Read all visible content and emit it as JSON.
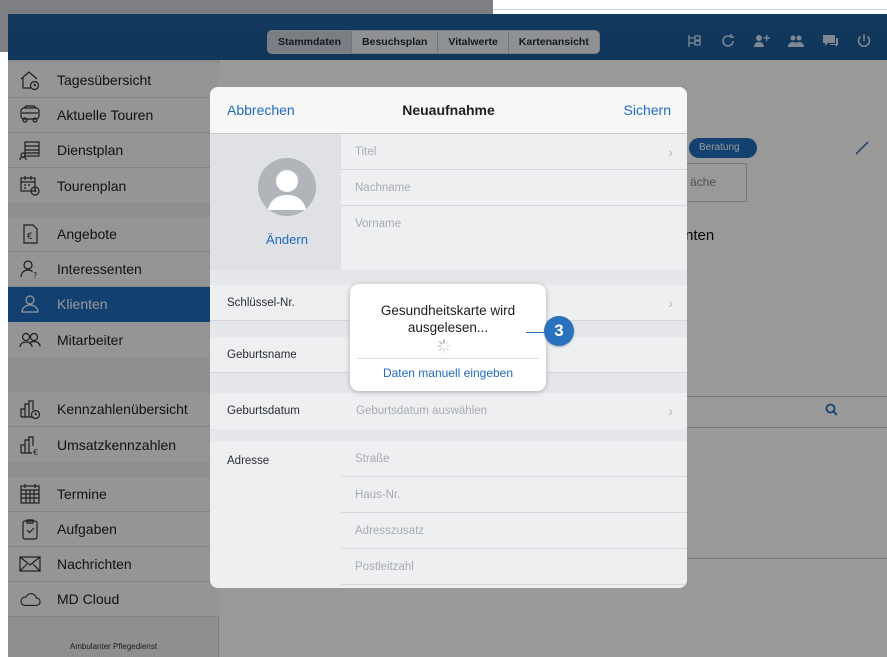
{
  "topbar": {
    "tabs": [
      {
        "label": "Stammdaten",
        "active": true
      },
      {
        "label": "Besuchsplan",
        "active": false
      },
      {
        "label": "Vitalwerte",
        "active": false
      },
      {
        "label": "Kartenansicht",
        "active": false
      }
    ],
    "icons": [
      "tree-icon",
      "refresh-icon",
      "add-user-icon",
      "group-icon",
      "chat-icon",
      "power-icon"
    ]
  },
  "sidebar": {
    "items": [
      {
        "label": "Tagesübersicht",
        "icon": "house-clock-icon"
      },
      {
        "label": "Aktuelle Touren",
        "icon": "car-icon"
      },
      {
        "label": "Dienstplan",
        "icon": "roster-icon"
      },
      {
        "label": "Tourenplan",
        "icon": "calendar-clock-icon"
      },
      {
        "label": "Angebote",
        "icon": "euro-doc-icon"
      },
      {
        "label": "Interessenten",
        "icon": "person-question-icon"
      },
      {
        "label": "Klienten",
        "icon": "person-icon",
        "active": true
      },
      {
        "label": "Mitarbeiter",
        "icon": "people-icon"
      },
      {
        "label": "Kennzahlenübersicht",
        "icon": "chart-clock-icon"
      },
      {
        "label": "Umsatzkennzahlen",
        "icon": "chart-euro-icon"
      },
      {
        "label": "Termine",
        "icon": "calendar-icon"
      },
      {
        "label": "Aufgaben",
        "icon": "clipboard-check-icon"
      },
      {
        "label": "Nachrichten",
        "icon": "envelope-icon"
      },
      {
        "label": "MD Cloud",
        "icon": "cloud-icon"
      }
    ],
    "footer": "Ambulanter Pflegedienst"
  },
  "background": {
    "pill_label": "Beratung",
    "box_label": "äche",
    "heading": "nten"
  },
  "modal": {
    "cancel": "Abbrechen",
    "title": "Neuaufnahme",
    "save": "Sichern",
    "photo_change": "Ändern",
    "name_fields": [
      "Titel",
      "Nachname",
      "Vorname"
    ],
    "rows": {
      "key_label": "Schlüssel-Nr.",
      "birthname_label": "Geburtsname",
      "birthdate_label": "Geburtsdatum",
      "birthdate_placeholder": "Geburtsdatum auswählen"
    },
    "address": {
      "label": "Adresse",
      "fields": [
        "Straße",
        "Haus-Nr.",
        "Adresszusatz",
        "Postleitzahl"
      ]
    }
  },
  "alert": {
    "message": "Gesundheitskarte wird ausgelesen...",
    "action": "Daten manuell eingeben"
  },
  "callout": {
    "number": "3",
    "color": "#2a72bd"
  },
  "colors": {
    "accent": "#1f6bbd",
    "topbar": "#1f5f9e"
  }
}
